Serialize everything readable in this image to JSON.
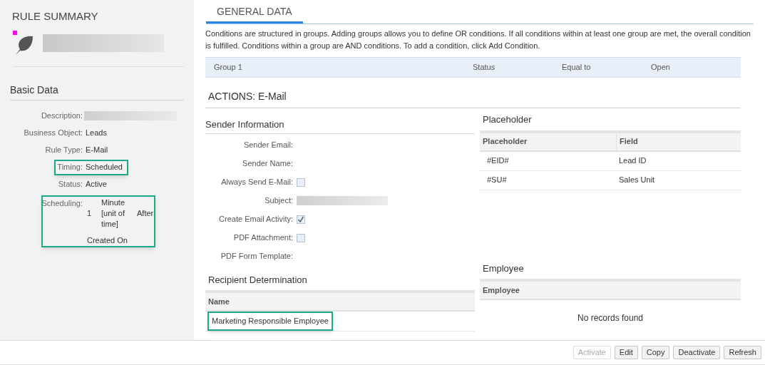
{
  "summary": {
    "title": "RULE SUMMARY",
    "section": "Basic Data",
    "fields": [
      {
        "label": "Description:",
        "kind": "redacted",
        "highlighted": false
      },
      {
        "label": "Business Object:",
        "kind": "text",
        "value": "Leads",
        "highlighted": false
      },
      {
        "label": "Rule Type:",
        "kind": "text",
        "value": "E-Mail",
        "highlighted": false
      },
      {
        "label": "Timing:",
        "kind": "text",
        "value": "Scheduled",
        "highlighted": true
      },
      {
        "label": "Status:",
        "kind": "text",
        "value": "Active",
        "highlighted": false
      },
      {
        "label": "Scheduling:",
        "kind": "schedule",
        "amount": "1",
        "unit": "Minute [unit of time]",
        "relation": "After",
        "reference": "Created On",
        "highlighted": true
      }
    ]
  },
  "tabs": [
    {
      "label": "GENERAL DATA",
      "selected": true
    }
  ],
  "conditions": {
    "hint": "Conditions are structured in groups. Adding groups allows you to define OR conditions. If all conditions within at least one group are met, the overall condition is fulfilled. Conditions within a group are AND conditions. To add a condition, click Add Condition.",
    "groups": [
      {
        "name": "Group 1",
        "field": "Status",
        "operator": "Equal to",
        "value": "Open"
      }
    ]
  },
  "actions_title": "ACTIONS: E-Mail",
  "sender": {
    "title": "Sender Information",
    "fields": [
      {
        "label": "Sender Email:",
        "kind": "empty"
      },
      {
        "label": "Sender Name:",
        "kind": "empty"
      },
      {
        "label": "Always Send E-Mail:",
        "kind": "checkbox",
        "checked": false
      },
      {
        "label": "Subject:",
        "kind": "redacted"
      },
      {
        "label": "Create Email Activity:",
        "kind": "checkbox",
        "checked": true
      },
      {
        "label": "PDF Attachment:",
        "kind": "checkbox",
        "checked": false
      },
      {
        "label": "PDF Form Template:",
        "kind": "empty"
      }
    ]
  },
  "placeholder": {
    "title": "Placeholder",
    "columns": [
      "Placeholder",
      "Field"
    ],
    "rows": [
      [
        "#EID#",
        "Lead ID"
      ],
      [
        "#SU#",
        "Sales Unit"
      ]
    ]
  },
  "recipients": {
    "title": "Recipient Determination",
    "columns": [
      "Name"
    ],
    "rows": [
      {
        "name": "Marketing Responsible Employee",
        "highlighted": true
      }
    ]
  },
  "employee": {
    "title": "Employee",
    "columns": [
      "Employee"
    ],
    "empty_text": "No records found"
  },
  "buttons": [
    {
      "label": "Activate",
      "disabled": true
    },
    {
      "label": "Edit",
      "disabled": false
    },
    {
      "label": "Copy",
      "disabled": false
    },
    {
      "label": "Deactivate",
      "disabled": false
    },
    {
      "label": "Refresh",
      "disabled": false
    }
  ]
}
